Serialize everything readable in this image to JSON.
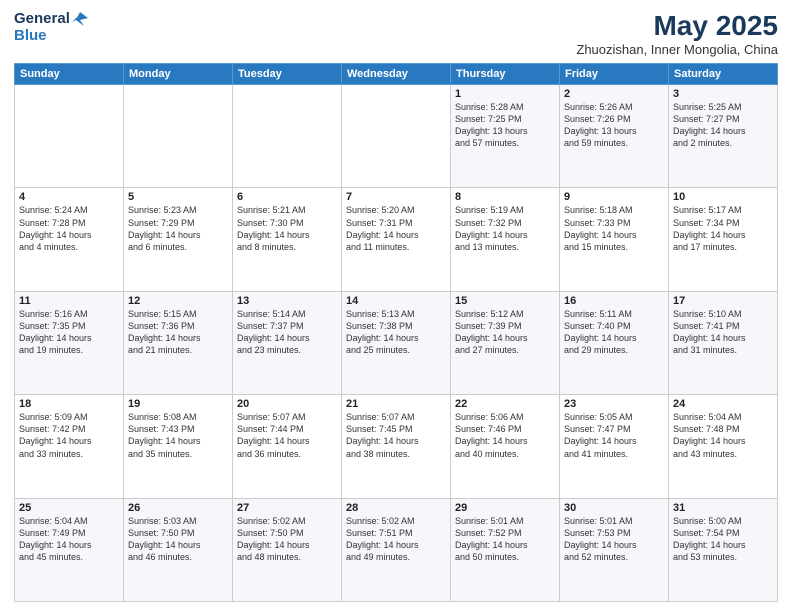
{
  "header": {
    "logo_general": "General",
    "logo_blue": "Blue",
    "month_title": "May 2025",
    "location": "Zhuozishan, Inner Mongolia, China"
  },
  "weekdays": [
    "Sunday",
    "Monday",
    "Tuesday",
    "Wednesday",
    "Thursday",
    "Friday",
    "Saturday"
  ],
  "weeks": [
    [
      {
        "day": "",
        "info": ""
      },
      {
        "day": "",
        "info": ""
      },
      {
        "day": "",
        "info": ""
      },
      {
        "day": "",
        "info": ""
      },
      {
        "day": "1",
        "info": "Sunrise: 5:28 AM\nSunset: 7:25 PM\nDaylight: 13 hours\nand 57 minutes."
      },
      {
        "day": "2",
        "info": "Sunrise: 5:26 AM\nSunset: 7:26 PM\nDaylight: 13 hours\nand 59 minutes."
      },
      {
        "day": "3",
        "info": "Sunrise: 5:25 AM\nSunset: 7:27 PM\nDaylight: 14 hours\nand 2 minutes."
      }
    ],
    [
      {
        "day": "4",
        "info": "Sunrise: 5:24 AM\nSunset: 7:28 PM\nDaylight: 14 hours\nand 4 minutes."
      },
      {
        "day": "5",
        "info": "Sunrise: 5:23 AM\nSunset: 7:29 PM\nDaylight: 14 hours\nand 6 minutes."
      },
      {
        "day": "6",
        "info": "Sunrise: 5:21 AM\nSunset: 7:30 PM\nDaylight: 14 hours\nand 8 minutes."
      },
      {
        "day": "7",
        "info": "Sunrise: 5:20 AM\nSunset: 7:31 PM\nDaylight: 14 hours\nand 11 minutes."
      },
      {
        "day": "8",
        "info": "Sunrise: 5:19 AM\nSunset: 7:32 PM\nDaylight: 14 hours\nand 13 minutes."
      },
      {
        "day": "9",
        "info": "Sunrise: 5:18 AM\nSunset: 7:33 PM\nDaylight: 14 hours\nand 15 minutes."
      },
      {
        "day": "10",
        "info": "Sunrise: 5:17 AM\nSunset: 7:34 PM\nDaylight: 14 hours\nand 17 minutes."
      }
    ],
    [
      {
        "day": "11",
        "info": "Sunrise: 5:16 AM\nSunset: 7:35 PM\nDaylight: 14 hours\nand 19 minutes."
      },
      {
        "day": "12",
        "info": "Sunrise: 5:15 AM\nSunset: 7:36 PM\nDaylight: 14 hours\nand 21 minutes."
      },
      {
        "day": "13",
        "info": "Sunrise: 5:14 AM\nSunset: 7:37 PM\nDaylight: 14 hours\nand 23 minutes."
      },
      {
        "day": "14",
        "info": "Sunrise: 5:13 AM\nSunset: 7:38 PM\nDaylight: 14 hours\nand 25 minutes."
      },
      {
        "day": "15",
        "info": "Sunrise: 5:12 AM\nSunset: 7:39 PM\nDaylight: 14 hours\nand 27 minutes."
      },
      {
        "day": "16",
        "info": "Sunrise: 5:11 AM\nSunset: 7:40 PM\nDaylight: 14 hours\nand 29 minutes."
      },
      {
        "day": "17",
        "info": "Sunrise: 5:10 AM\nSunset: 7:41 PM\nDaylight: 14 hours\nand 31 minutes."
      }
    ],
    [
      {
        "day": "18",
        "info": "Sunrise: 5:09 AM\nSunset: 7:42 PM\nDaylight: 14 hours\nand 33 minutes."
      },
      {
        "day": "19",
        "info": "Sunrise: 5:08 AM\nSunset: 7:43 PM\nDaylight: 14 hours\nand 35 minutes."
      },
      {
        "day": "20",
        "info": "Sunrise: 5:07 AM\nSunset: 7:44 PM\nDaylight: 14 hours\nand 36 minutes."
      },
      {
        "day": "21",
        "info": "Sunrise: 5:07 AM\nSunset: 7:45 PM\nDaylight: 14 hours\nand 38 minutes."
      },
      {
        "day": "22",
        "info": "Sunrise: 5:06 AM\nSunset: 7:46 PM\nDaylight: 14 hours\nand 40 minutes."
      },
      {
        "day": "23",
        "info": "Sunrise: 5:05 AM\nSunset: 7:47 PM\nDaylight: 14 hours\nand 41 minutes."
      },
      {
        "day": "24",
        "info": "Sunrise: 5:04 AM\nSunset: 7:48 PM\nDaylight: 14 hours\nand 43 minutes."
      }
    ],
    [
      {
        "day": "25",
        "info": "Sunrise: 5:04 AM\nSunset: 7:49 PM\nDaylight: 14 hours\nand 45 minutes."
      },
      {
        "day": "26",
        "info": "Sunrise: 5:03 AM\nSunset: 7:50 PM\nDaylight: 14 hours\nand 46 minutes."
      },
      {
        "day": "27",
        "info": "Sunrise: 5:02 AM\nSunset: 7:50 PM\nDaylight: 14 hours\nand 48 minutes."
      },
      {
        "day": "28",
        "info": "Sunrise: 5:02 AM\nSunset: 7:51 PM\nDaylight: 14 hours\nand 49 minutes."
      },
      {
        "day": "29",
        "info": "Sunrise: 5:01 AM\nSunset: 7:52 PM\nDaylight: 14 hours\nand 50 minutes."
      },
      {
        "day": "30",
        "info": "Sunrise: 5:01 AM\nSunset: 7:53 PM\nDaylight: 14 hours\nand 52 minutes."
      },
      {
        "day": "31",
        "info": "Sunrise: 5:00 AM\nSunset: 7:54 PM\nDaylight: 14 hours\nand 53 minutes."
      }
    ]
  ]
}
